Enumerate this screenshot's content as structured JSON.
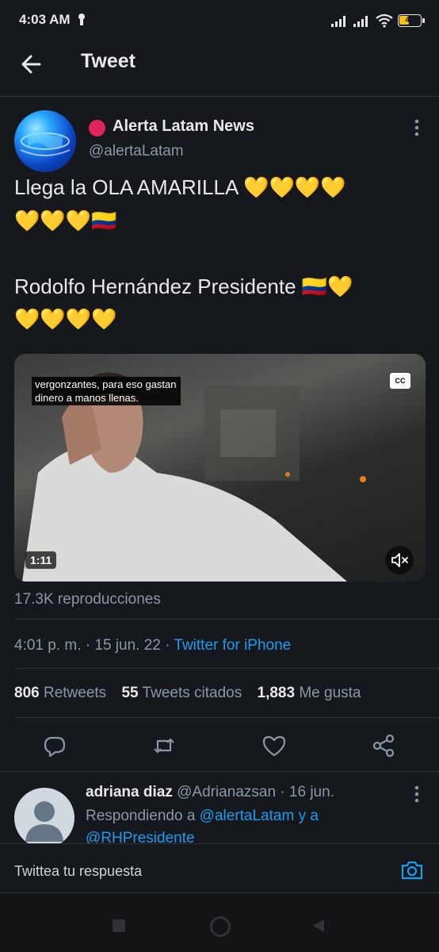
{
  "status_bar": {
    "time": "4:03 AM",
    "battery": "41"
  },
  "header": {
    "title": "Tweet"
  },
  "tweet": {
    "author": "Alerta Latam News",
    "handle": "@alertaLatam",
    "text_line1": "Llega la OLA AMARILLA 💛💛💛💛",
    "text_line2": "💛💛💛🇨🇴",
    "text_line3": "Rodolfo Hernández Presidente 🇨🇴💛",
    "text_line4": "💛💛💛💛",
    "video": {
      "subtitle": "vergonzantes, para eso gastan dinero a manos llenas.",
      "cc": "CC",
      "duration": "1:11"
    },
    "views": "17.3K reproducciones",
    "time": "4:01 p. m.",
    "sep1": "·",
    "date": "15 jun. 22",
    "sep2": "·",
    "source": "Twitter for iPhone",
    "retweets_count": "806",
    "retweets_label": "Retweets",
    "quotes_count": "55",
    "quotes_label": "Tweets citados",
    "likes_count": "1,883",
    "likes_label": "Me gusta"
  },
  "reply": {
    "name": "adriana diaz",
    "handle": "@Adrianazsan",
    "sep": "·",
    "date": "16 jun.",
    "replying_prefix": "Respondiendo a",
    "mention1": "@alertaLatam",
    "and": "y a",
    "mention2": "@RHPresidente"
  },
  "compose": {
    "placeholder": "Twittea tu respuesta"
  },
  "colors": {
    "background": "#15181c",
    "accent": "#1d9bf0",
    "muted": "#8b98a5",
    "live_dot": "#e0245e"
  }
}
